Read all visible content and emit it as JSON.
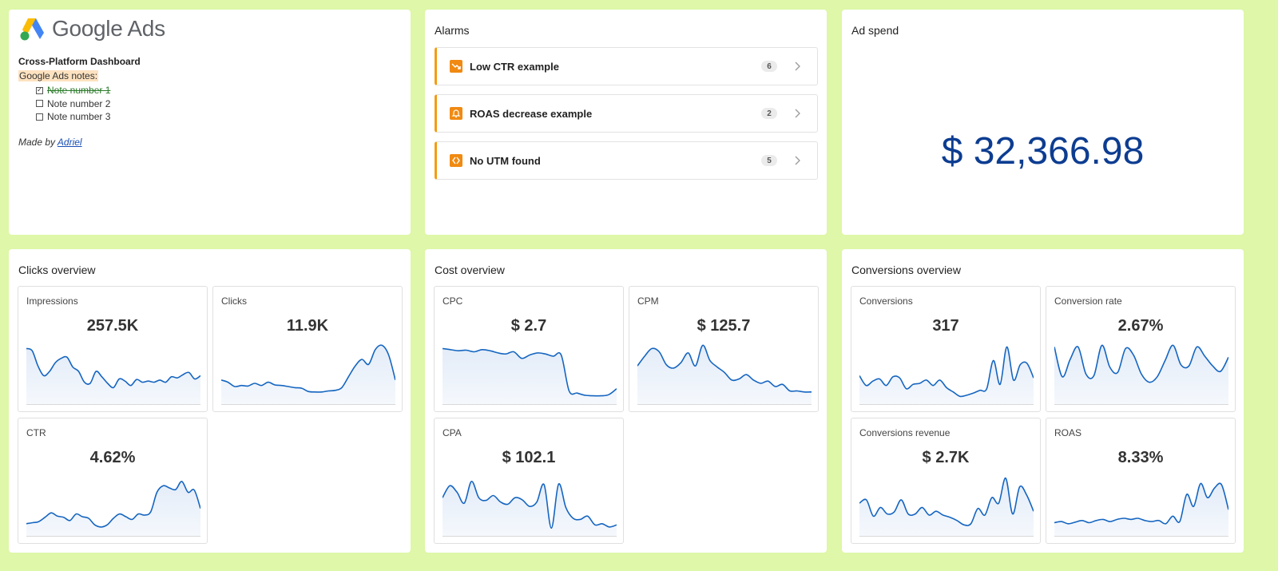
{
  "colors": {
    "background": "#def7a8",
    "accent_orange": "#f39c12",
    "spend_blue": "#0d3d91",
    "spark_line": "#1565c0",
    "spark_fill": "#e3ecf8"
  },
  "brand": {
    "logo_icon": "google-ads-logo-icon",
    "name": "Google Ads"
  },
  "notes_panel": {
    "title": "Cross-Platform Dashboard",
    "notes_label": "Google Ads notes:",
    "notes": [
      {
        "text": "Note number 1",
        "checked": true
      },
      {
        "text": "Note number 2",
        "checked": false
      },
      {
        "text": "Note number 3",
        "checked": false
      }
    ],
    "made_by_prefix": "Made by ",
    "made_by_link": "Adriel"
  },
  "alarms": {
    "title": "Alarms",
    "items": [
      {
        "label": "Low CTR example",
        "count": "6",
        "icon": "trend-down-icon"
      },
      {
        "label": "ROAS decrease example",
        "count": "2",
        "icon": "bell-icon"
      },
      {
        "label": "No UTM found",
        "count": "5",
        "icon": "link-icon"
      }
    ]
  },
  "ad_spend": {
    "title": "Ad spend",
    "value": "$ 32,366.98"
  },
  "sections": [
    {
      "title": "Clicks overview",
      "cards": [
        {
          "label": "Impressions",
          "value": "257.5K",
          "trend": [
            0.92,
            0.88,
            0.6,
            0.42,
            0.5,
            0.66,
            0.74,
            0.76,
            0.58,
            0.5,
            0.3,
            0.28,
            0.5,
            0.4,
            0.28,
            0.2,
            0.36,
            0.32,
            0.24,
            0.35,
            0.3,
            0.32,
            0.3,
            0.34,
            0.3,
            0.4,
            0.38,
            0.44,
            0.48,
            0.36,
            0.42
          ]
        },
        {
          "label": "Clicks",
          "value": "11.9K",
          "trend": [
            0.34,
            0.3,
            0.22,
            0.24,
            0.23,
            0.28,
            0.24,
            0.3,
            0.25,
            0.24,
            0.22,
            0.2,
            0.19,
            0.13,
            0.12,
            0.12,
            0.14,
            0.15,
            0.2,
            0.4,
            0.6,
            0.72,
            0.63,
            0.9,
            0.98,
            0.8,
            0.34
          ]
        },
        {
          "label": "CTR",
          "value": "4.62%",
          "trend": [
            0.12,
            0.14,
            0.16,
            0.24,
            0.32,
            0.26,
            0.24,
            0.18,
            0.3,
            0.25,
            0.22,
            0.1,
            0.06,
            0.1,
            0.22,
            0.3,
            0.25,
            0.2,
            0.3,
            0.28,
            0.34,
            0.7,
            0.82,
            0.78,
            0.75,
            0.9,
            0.7,
            0.74,
            0.4
          ]
        }
      ]
    },
    {
      "title": "Cost overview",
      "cards": [
        {
          "label": "CPC",
          "value": "$ 2.7",
          "trend": [
            0.92,
            0.9,
            0.88,
            0.89,
            0.86,
            0.9,
            0.88,
            0.84,
            0.82,
            0.86,
            0.74,
            0.8,
            0.84,
            0.82,
            0.78,
            0.8,
            0.14,
            0.1,
            0.06,
            0.05,
            0.05,
            0.07,
            0.18
          ]
        },
        {
          "label": "CPM",
          "value": "$ 125.7",
          "trend": [
            0.6,
            0.78,
            0.92,
            0.86,
            0.62,
            0.56,
            0.66,
            0.84,
            0.6,
            0.98,
            0.7,
            0.58,
            0.48,
            0.34,
            0.36,
            0.44,
            0.34,
            0.28,
            0.32,
            0.22,
            0.26,
            0.14,
            0.14,
            0.12,
            0.12
          ]
        },
        {
          "label": "CPA",
          "value": "$ 102.1",
          "trend": [
            0.6,
            0.82,
            0.7,
            0.5,
            0.9,
            0.6,
            0.55,
            0.64,
            0.52,
            0.48,
            0.6,
            0.56,
            0.44,
            0.52,
            0.84,
            0.04,
            0.85,
            0.42,
            0.22,
            0.2,
            0.26,
            0.1,
            0.12,
            0.06,
            0.1
          ]
        }
      ]
    },
    {
      "title": "Conversions overview",
      "cards": [
        {
          "label": "Conversions",
          "value": "317",
          "trend": [
            0.42,
            0.24,
            0.32,
            0.36,
            0.24,
            0.4,
            0.38,
            0.18,
            0.26,
            0.28,
            0.34,
            0.24,
            0.34,
            0.2,
            0.12,
            0.04,
            0.06,
            0.1,
            0.15,
            0.18,
            0.7,
            0.26,
            0.95,
            0.34,
            0.62,
            0.65,
            0.38
          ]
        },
        {
          "label": "Conversion rate",
          "value": "2.67%",
          "trend": [
            0.95,
            0.4,
            0.72,
            0.95,
            0.45,
            0.42,
            0.98,
            0.58,
            0.48,
            0.92,
            0.8,
            0.45,
            0.3,
            0.4,
            0.7,
            0.98,
            0.62,
            0.6,
            0.95,
            0.78,
            0.6,
            0.5,
            0.76
          ]
        },
        {
          "label": "Conversions revenue",
          "value": "$ 2.7K",
          "trend": [
            0.5,
            0.56,
            0.26,
            0.42,
            0.3,
            0.34,
            0.56,
            0.3,
            0.3,
            0.42,
            0.28,
            0.35,
            0.28,
            0.24,
            0.18,
            0.1,
            0.12,
            0.4,
            0.28,
            0.6,
            0.5,
            0.96,
            0.3,
            0.8,
            0.65,
            0.35
          ]
        },
        {
          "label": "ROAS",
          "value": "8.33%",
          "trend": [
            0.14,
            0.16,
            0.12,
            0.15,
            0.18,
            0.14,
            0.18,
            0.2,
            0.16,
            0.2,
            0.22,
            0.2,
            0.22,
            0.18,
            0.16,
            0.18,
            0.12,
            0.26,
            0.16,
            0.66,
            0.44,
            0.86,
            0.6,
            0.78,
            0.84,
            0.38
          ]
        }
      ]
    }
  ]
}
